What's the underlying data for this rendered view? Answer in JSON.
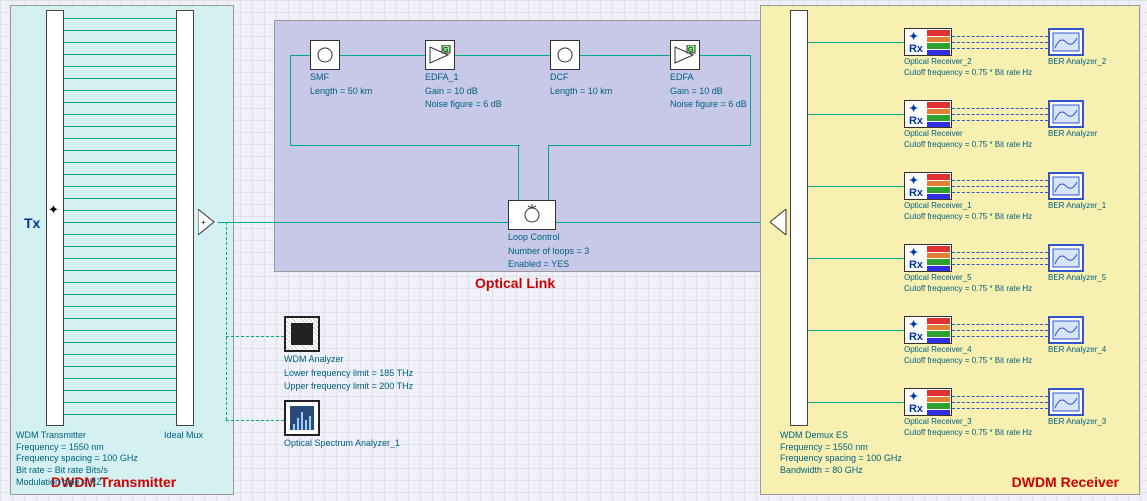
{
  "regions": {
    "transmitter": {
      "title": "DWDM Transmitter"
    },
    "link": {
      "title": "Optical Link"
    },
    "receiver": {
      "title": "DWDM Receiver"
    }
  },
  "transmitter": {
    "tx_label": "Tx",
    "wdm_tx": {
      "name": "WDM Transmitter",
      "freq": "Frequency = 1550  nm",
      "spacing": "Frequency spacing = 100  GHz",
      "bitrate": "Bit rate = Bit rate  Bits/s",
      "mod": "Modulation type = RZ"
    },
    "mux_label": "Ideal Mux"
  },
  "link": {
    "smf": {
      "name": "SMF",
      "length": "Length = 50  km"
    },
    "edfa1": {
      "name": "EDFA_1",
      "gain": "Gain = 10  dB",
      "nf": "Noise figure = 6  dB"
    },
    "dcf": {
      "name": "DCF",
      "length": "Length = 10  km"
    },
    "edfa2": {
      "name": "EDFA",
      "gain": "Gain = 10  dB",
      "nf": "Noise figure = 6  dB"
    },
    "loop": {
      "name": "Loop Control",
      "loops": "Number of loops = 3",
      "enabled": "Enabled = YES"
    }
  },
  "analyzers": {
    "wdm": {
      "name": "WDM Analyzer",
      "lower": "Lower frequency limit = 185  THz",
      "upper": "Upper frequency limit = 200  THz"
    },
    "osa": {
      "name": "Optical Spectrum Analyzer_1"
    }
  },
  "receiver": {
    "demux": {
      "name": "WDM Demux ES",
      "freq": "Frequency = 1550  nm",
      "spacing": "Frequency spacing = 100  GHz",
      "bw": "Bandwidth = 80  GHz"
    },
    "rows": [
      {
        "rx_name": "Optical Receiver_2",
        "rx_cutoff": "Cutoff frequency = 0.75 * Bit rate  Hz",
        "ber_name": "BER Analyzer_2"
      },
      {
        "rx_name": "Optical Receiver",
        "rx_cutoff": "Cutoff frequency = 0.75 * Bit rate  Hz",
        "ber_name": "BER Analyzer"
      },
      {
        "rx_name": "Optical Receiver_1",
        "rx_cutoff": "Cutoff frequency = 0.75 * Bit rate  Hz",
        "ber_name": "BER Analyzer_1"
      },
      {
        "rx_name": "Optical Receiver_5",
        "rx_cutoff": "Cutoff frequency = 0.75 * Bit rate  Hz",
        "ber_name": "BER Analyzer_5"
      },
      {
        "rx_name": "Optical Receiver_4",
        "rx_cutoff": "Cutoff frequency = 0.75 * Bit rate  Hz",
        "ber_name": "BER Analyzer_4"
      },
      {
        "rx_name": "Optical Receiver_3",
        "rx_cutoff": "Cutoff frequency = 0.75 * Bit rate  Hz",
        "ber_name": "BER Analyzer_3"
      }
    ]
  }
}
